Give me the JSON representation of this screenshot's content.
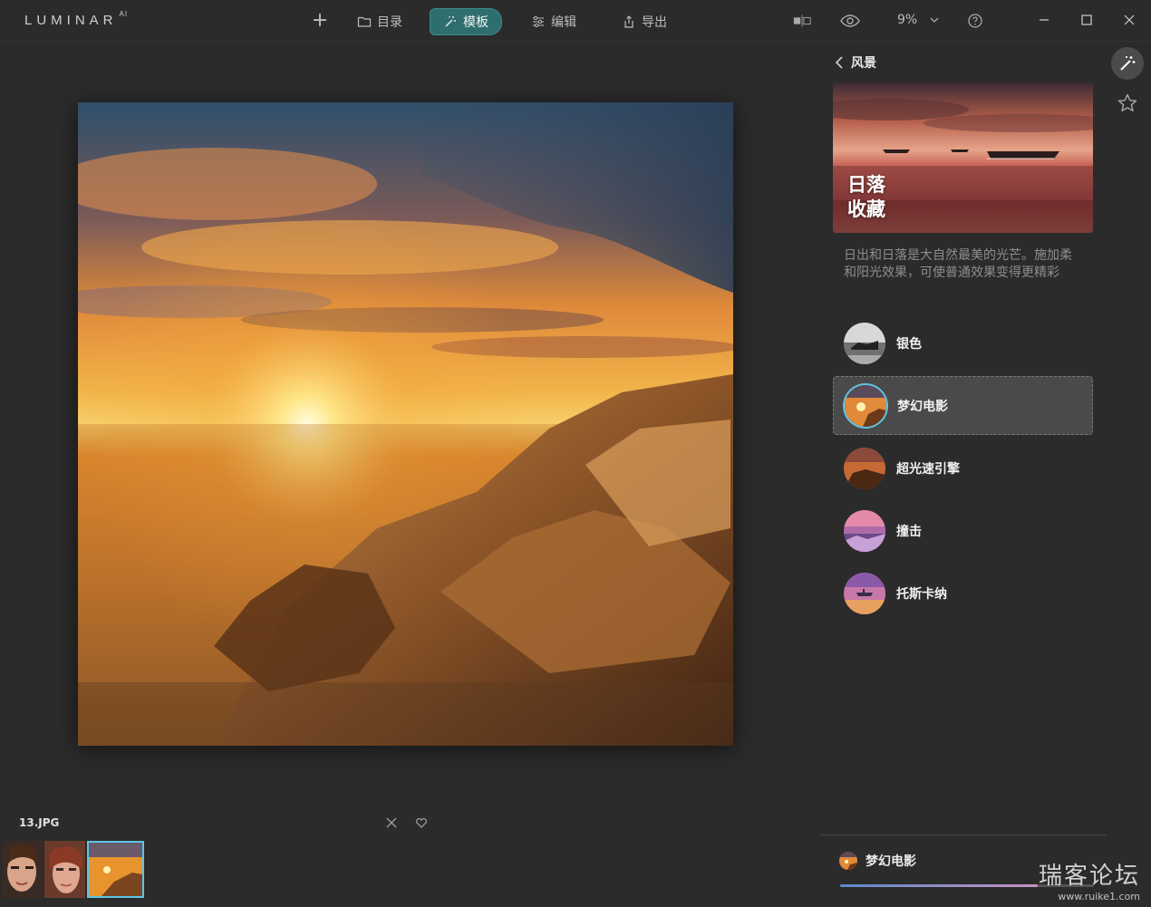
{
  "app": {
    "logo": "LUMINAR",
    "logo_suffix": "AI"
  },
  "toolbar": {
    "add_label": "+",
    "tabs": [
      {
        "label": "目录",
        "icon": "folder-icon",
        "active": false
      },
      {
        "label": "模板",
        "icon": "magic-wand-icon",
        "active": true
      },
      {
        "label": "编辑",
        "icon": "sliders-icon",
        "active": false
      },
      {
        "label": "导出",
        "icon": "share-icon",
        "active": false
      }
    ],
    "zoom_label": "9%",
    "accent": "#2f6e6f"
  },
  "panel": {
    "back_label": "风景",
    "hero_title_line1": "日落",
    "hero_title_line2": "收藏",
    "description": "日出和日落是大自然最美的光芒。施加柔和阳光效果，可使普通效果变得更精彩",
    "looks": [
      {
        "label": "银色",
        "selected": false
      },
      {
        "label": "梦幻电影",
        "selected": true
      },
      {
        "label": "超光速引擎",
        "selected": false
      },
      {
        "label": "撞击",
        "selected": false
      },
      {
        "label": "托斯卡纳",
        "selected": false
      }
    ],
    "applied_label": "梦幻电影",
    "applied_amount": 0.78,
    "selection_color": "#5bc6e6"
  },
  "filmstrip": {
    "file_name": "13.JPG"
  },
  "watermark": {
    "big": "瑞客论坛",
    "small": "www.ruike1.com"
  }
}
